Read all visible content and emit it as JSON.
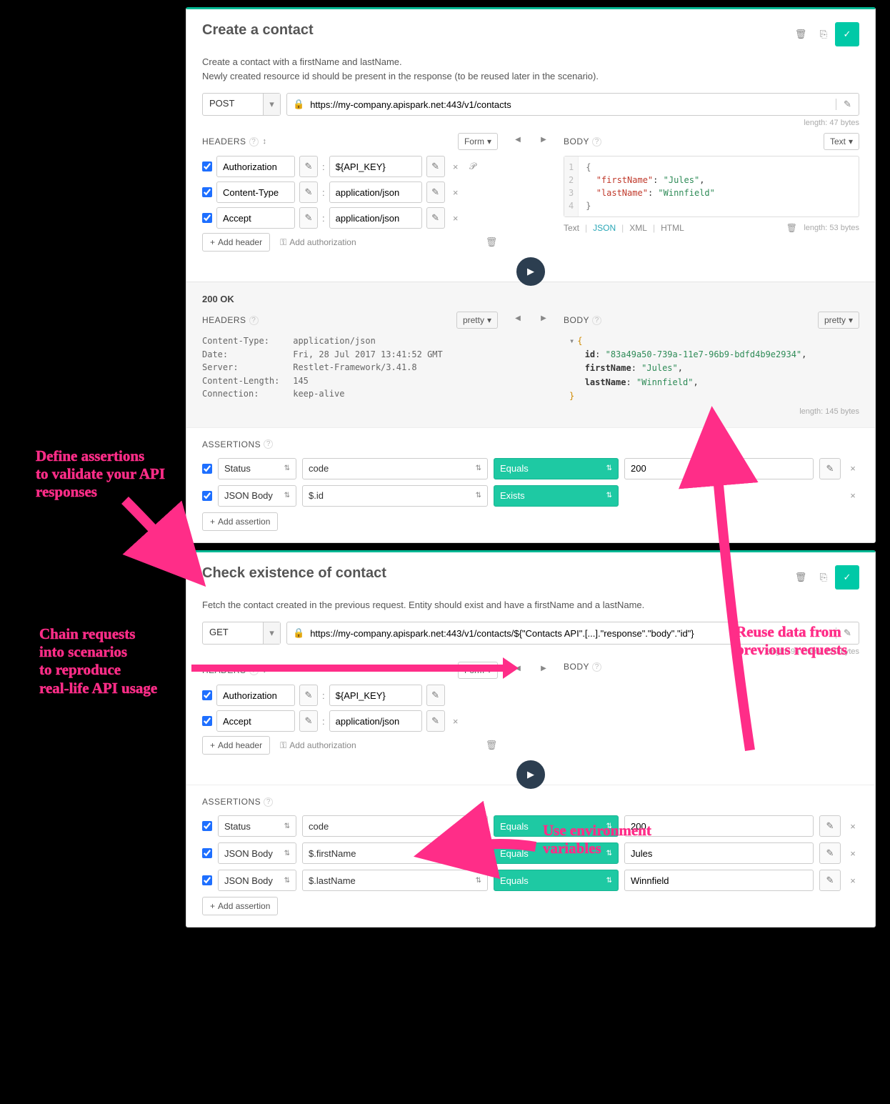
{
  "card1": {
    "title": "Create a contact",
    "desc1": "Create a contact with a firstName and lastName.",
    "desc2": "Newly created resource id should be present in the response (to be reused later in the scenario).",
    "method": "POST",
    "url": "https://my-company.apispark.net:443/v1/contacts",
    "url_len": "length: 47 bytes",
    "headers_label": "HEADERS",
    "form_mode": "Form",
    "headers": [
      {
        "name": "Authorization",
        "value": "${API_KEY}",
        "extra_icons": [
          "x",
          "vars"
        ]
      },
      {
        "name": "Content-Type",
        "value": "application/json",
        "extra_icons": [
          "x"
        ]
      },
      {
        "name": "Accept",
        "value": "application/json",
        "extra_icons": [
          "x"
        ]
      }
    ],
    "add_header": "Add header",
    "add_auth": "Add authorization",
    "body_label": "BODY",
    "body_mode": "Text",
    "body_json": {
      "firstName": "Jules",
      "lastName": "Winnfield"
    },
    "format_bar": {
      "t": "Text",
      "j": "JSON",
      "x": "XML",
      "h": "HTML",
      "len": "length: 53 bytes"
    },
    "response": {
      "status": "200 OK",
      "hdr_mode": "pretty",
      "body_mode": "pretty",
      "headers": [
        [
          "Content-Type:",
          "application/json"
        ],
        [
          "Date:",
          "Fri, 28 Jul 2017 13:41:52 GMT"
        ],
        [
          "Server:",
          "Restlet-Framework/3.41.8"
        ],
        [
          "Content-Length:",
          "145"
        ],
        [
          "Connection:",
          "keep-alive"
        ]
      ],
      "body": {
        "id": "83a49a50-739a-11e7-96b9-bdfd4b9e2934",
        "firstName": "Jules",
        "lastName": "Winnfield"
      },
      "len": "length: 145 bytes"
    },
    "assert_label": "ASSERTIONS",
    "assertions": [
      {
        "src": "Status",
        "prop": "code",
        "op": "Equals",
        "val": "200",
        "editable": true
      },
      {
        "src": "JSON Body",
        "prop": "$.id",
        "op": "Exists",
        "val": null,
        "editable": false
      }
    ],
    "add_assert": "Add assertion"
  },
  "card2": {
    "title": "Check existence of contact",
    "desc": "Fetch the contact created in the previous request. Entity should exist and have a firstName and a lastName.",
    "method": "GET",
    "url": "https://my-company.apispark.net:443/v1/contacts/${\"Contacts API\".[...].\"response\".\"body\".\"id\"}",
    "url_len": "length: 94 chars, 120 bytes",
    "headers": [
      {
        "name": "Authorization",
        "value": "${API_KEY}",
        "extra_icons": []
      },
      {
        "name": "Accept",
        "value": "application/json",
        "extra_icons": [
          "x"
        ]
      }
    ],
    "body_label": "BODY",
    "assertions": [
      {
        "src": "Status",
        "prop": "code",
        "op": "Equals",
        "val": "200"
      },
      {
        "src": "JSON Body",
        "prop": "$.firstName",
        "op": "Equals",
        "val": "Jules"
      },
      {
        "src": "JSON Body",
        "prop": "$.lastName",
        "op": "Equals",
        "val": "Winnfield"
      }
    ]
  },
  "annot": {
    "a1l1": "Define assertions",
    "a1l2": "to validate your API",
    "a1l3": "responses",
    "a2l1": "Chain requests",
    "a2l2": "into scenarios",
    "a2l3": "to reproduce",
    "a2l4": "real-life API usage",
    "a3l1": "Reuse data from",
    "a3l2": "previous requests",
    "a4l1": "Use environment",
    "a4l2": "variables"
  },
  "icons": {
    "trash": "🗑",
    "copy": "⎘",
    "check": "✓",
    "pencil": "✎",
    "lock": "🔒",
    "plus": "+",
    "key": "⚿",
    "sort": "↕",
    "play": "▶",
    "caret": "▾",
    "tri_l": "◀",
    "tri_r": "▶",
    "x": "×",
    "vars": "𝒫"
  }
}
